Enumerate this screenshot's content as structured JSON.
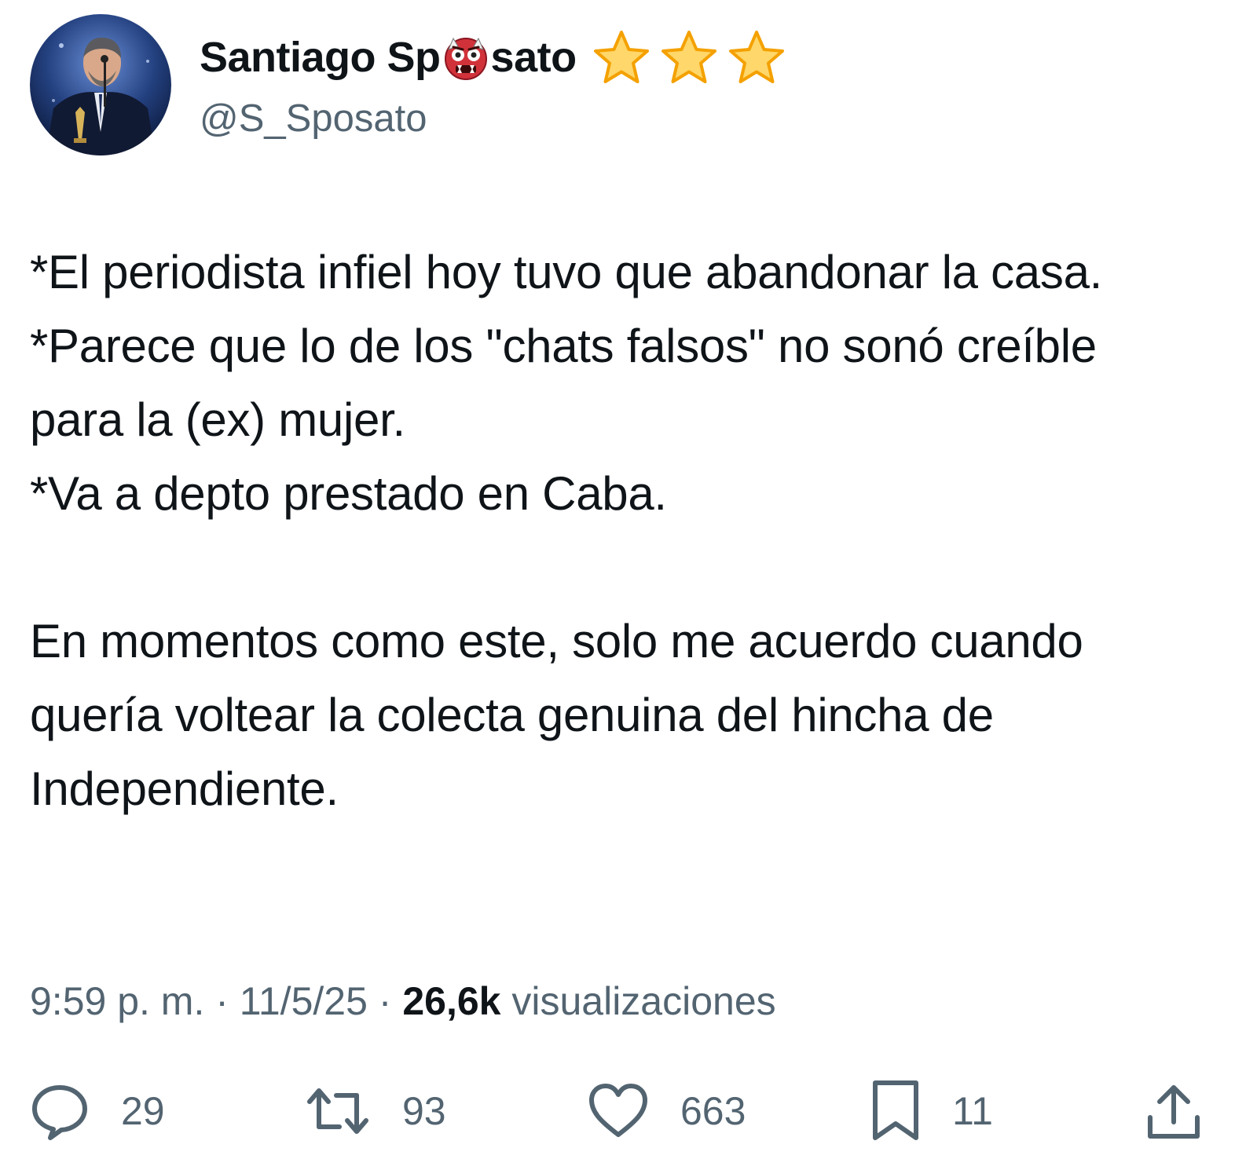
{
  "tweet": {
    "author": {
      "name_start": "Santiago Sp",
      "name_end": "sato",
      "name_emoji_icon": "ogre-face-icon",
      "badge_icons": [
        "star-icon",
        "star-icon",
        "star-icon"
      ],
      "handle": "@S_Sposato",
      "avatar_icon": "profile-photo-avatar"
    },
    "text": "*El periodista infiel hoy tuvo que abandonar la casa.\n*Parece que lo de los \"chats falsos\" no sonó creíble para la (ex) mujer.\n*Va a depto prestado en Caba.\n\nEn momentos como este, solo me acuerdo cuando quería voltear la colecta genuina del hincha de Independiente.",
    "meta": {
      "time": "9:59 p. m.",
      "separator": " · ",
      "date": "11/5/25",
      "views_count": "26,6k",
      "views_label": " visualizaciones"
    },
    "actions": {
      "replies": "29",
      "retweets": "93",
      "likes": "663",
      "bookmarks": "11"
    }
  },
  "colors": {
    "text_primary": "#0f1419",
    "text_secondary": "#536471",
    "star_fill": "#ffd76a",
    "star_stroke": "#f4a100",
    "ogre_red": "#d1323a"
  }
}
